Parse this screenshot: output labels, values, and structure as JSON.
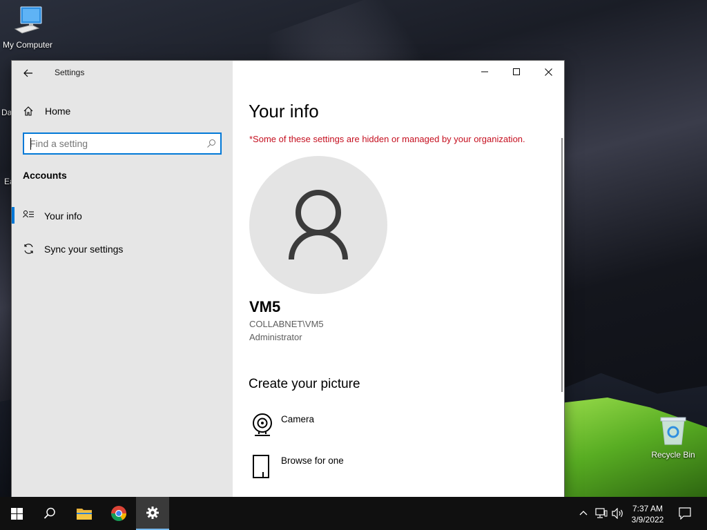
{
  "desktop": {
    "icons": [
      {
        "label": "My Computer"
      },
      {
        "label": "Recycle Bin"
      }
    ],
    "partial_labels": [
      "Da",
      "Ea"
    ]
  },
  "window": {
    "title": "Settings",
    "controls": {
      "minimize": "minimize",
      "maximize": "maximize",
      "close": "close"
    }
  },
  "nav": {
    "home_label": "Home",
    "search": {
      "placeholder": "Find a setting",
      "value": ""
    },
    "section_title": "Accounts",
    "items": [
      {
        "label": "Your info",
        "icon": "contact-info-icon",
        "selected": true
      },
      {
        "label": "Sync your settings",
        "icon": "sync-icon",
        "selected": false
      }
    ]
  },
  "main": {
    "heading": "Your info",
    "notice": "*Some of these settings are hidden or managed by your organization.",
    "user": {
      "name": "VM5",
      "account": "COLLABNET\\VM5",
      "role": "Administrator"
    },
    "create_picture": {
      "heading": "Create your picture",
      "options": [
        {
          "label": "Camera",
          "icon": "webcam-icon"
        },
        {
          "label": "Browse for one",
          "icon": "file-icon"
        }
      ]
    }
  },
  "taskbar": {
    "time": "7:37 AM",
    "date": "3/9/2022",
    "accent_color": "#76b9ed"
  },
  "colors": {
    "accent": "#0078d7",
    "notice": "#c50f1f",
    "nav_background": "#e6e6e6"
  }
}
